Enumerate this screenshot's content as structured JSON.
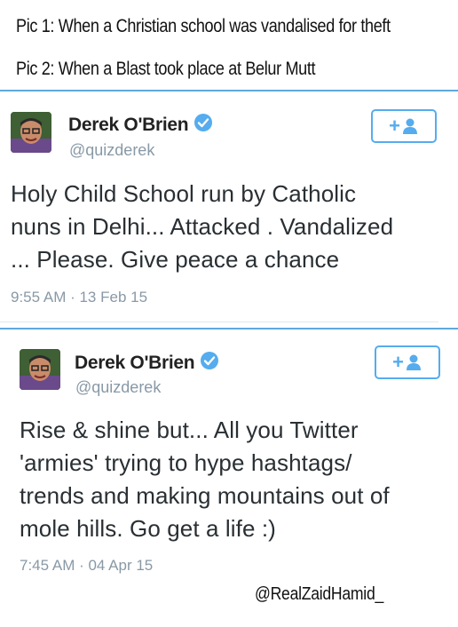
{
  "captions": {
    "pic1": "Pic 1: When a Christian school was vandalised for theft",
    "pic2": "Pic 2: When a Blast took place at Belur Mutt"
  },
  "tweets": [
    {
      "author_name": "Derek O'Brien",
      "handle": "@quizderek",
      "follow_icon": "add-user-icon",
      "text_lines": [
        "Holy Child School run by Catholic",
        "nuns in Delhi... Attacked . Vandalized",
        "... Please. Give peace a chance"
      ],
      "timestamp": "9:55 AM · 13 Feb 15"
    },
    {
      "author_name": "Derek O'Brien",
      "handle": "@quizderek",
      "follow_icon": "add-user-icon",
      "text_lines": [
        "Rise & shine but... All you Twitter",
        "'armies' trying to hype hashtags/",
        "trends and making mountains out of",
        "mole hills. Go get a life :)"
      ],
      "timestamp": "7:45 AM · 04 Apr 15"
    }
  ],
  "watermark": "@RealZaidHamid_",
  "colors": {
    "accent": "#55acee",
    "divider": "#5ea9dd",
    "secondary_text": "#8899a6",
    "verified_badge": "#55acee"
  }
}
